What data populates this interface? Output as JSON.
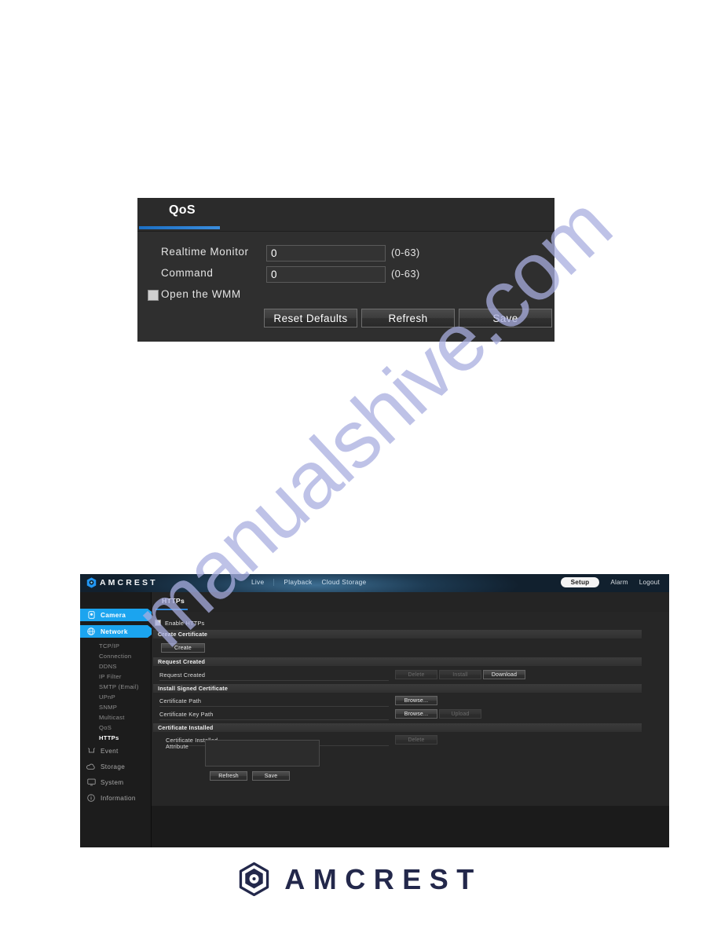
{
  "watermark": {
    "text": "manualshive.com"
  },
  "qos_figure": {
    "tab": {
      "label": "QoS"
    },
    "rows": [
      {
        "label": "Realtime Monitor",
        "value": "0",
        "hint": "(0-63)"
      },
      {
        "label": "Command",
        "value": "0",
        "hint": "(0-63)"
      }
    ],
    "checkbox": {
      "label": "Open the WMM",
      "checked": false
    },
    "buttons": [
      {
        "label": "Reset Defaults"
      },
      {
        "label": "Refresh"
      },
      {
        "label": "Save"
      }
    ]
  },
  "https_figure": {
    "header": {
      "brand": "AMCREST",
      "logo_icon": "hexagon-camera-icon",
      "nav": [
        {
          "label": "Live"
        },
        {
          "label": "Playback"
        },
        {
          "label": "Cloud Storage"
        }
      ],
      "right_nav": [
        {
          "label": "Setup",
          "active": true
        },
        {
          "label": "Alarm",
          "active": false
        },
        {
          "label": "Logout",
          "active": false
        }
      ]
    },
    "sidebar": {
      "groups": [
        {
          "label": "Camera",
          "icon": "camera-icon",
          "active": true
        },
        {
          "label": "Network",
          "icon": "network-globe-icon",
          "active": true
        }
      ],
      "network_children": [
        {
          "label": "TCP/IP",
          "selected": false
        },
        {
          "label": "Connection",
          "selected": false
        },
        {
          "label": "DDNS",
          "selected": false
        },
        {
          "label": "IP Filter",
          "selected": false
        },
        {
          "label": "SMTP (Email)",
          "selected": false
        },
        {
          "label": "UPnP",
          "selected": false
        },
        {
          "label": "SNMP",
          "selected": false
        },
        {
          "label": "Multicast",
          "selected": false
        },
        {
          "label": "QoS",
          "selected": false
        },
        {
          "label": "HTTPs",
          "selected": true
        }
      ],
      "lower_groups": [
        {
          "label": "Event",
          "icon": "event-bell-icon"
        },
        {
          "label": "Storage",
          "icon": "storage-cloud-icon"
        },
        {
          "label": "System",
          "icon": "system-monitor-icon"
        },
        {
          "label": "Information",
          "icon": "info-circle-icon"
        }
      ]
    },
    "tab": {
      "label": "HTTPs"
    },
    "enable": {
      "label": "Enable HTTPs",
      "checked": false
    },
    "sections": [
      {
        "title": "Create Certificate"
      },
      {
        "title": "Request Created"
      },
      {
        "title": "Install Signed Certificate"
      },
      {
        "title": "Certificate Installed"
      }
    ],
    "create_button": {
      "label": "Create",
      "disabled": false
    },
    "request_row": {
      "label": "Request Created",
      "value": "",
      "buttons": [
        {
          "label": "Delete",
          "disabled": true
        },
        {
          "label": "Install",
          "disabled": true
        },
        {
          "label": "Download",
          "disabled": false
        }
      ]
    },
    "cert_path_row": {
      "label": "Certificate Path",
      "value": "",
      "button": {
        "label": "Browse...",
        "disabled": false
      }
    },
    "cert_key_row": {
      "label": "Certificate Key Path",
      "value": "",
      "buttons": [
        {
          "label": "Browse...",
          "disabled": false
        },
        {
          "label": "Upload",
          "disabled": true
        }
      ]
    },
    "cert_installed_row": {
      "label": "Certificate Installed",
      "value": "",
      "button": {
        "label": "Delete",
        "disabled": true
      }
    },
    "attribute_row": {
      "label": "Attribute",
      "value": ""
    },
    "footer_buttons": [
      {
        "label": "Refresh"
      },
      {
        "label": "Save"
      }
    ]
  },
  "footer": {
    "brand": "AMCREST",
    "logo_icon": "hexagon-camera-icon"
  }
}
